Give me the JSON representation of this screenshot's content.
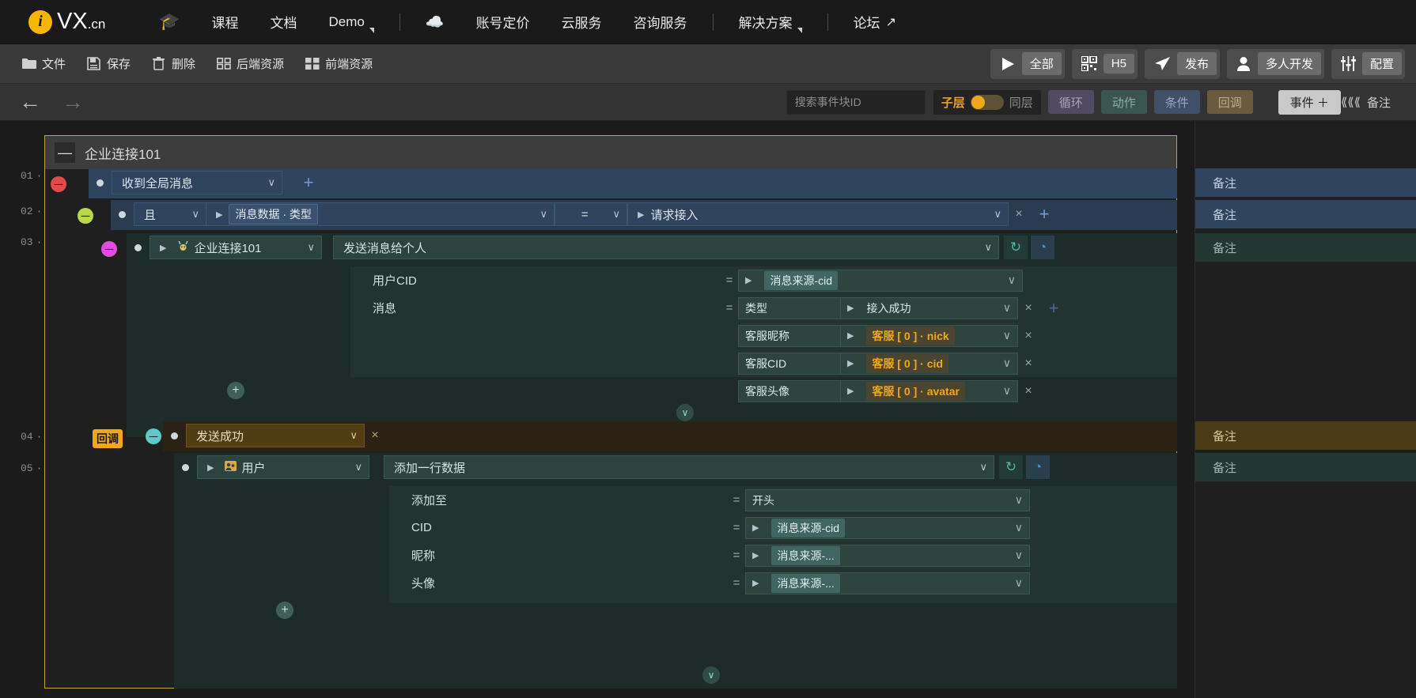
{
  "topnav": {
    "brand": {
      "logo_letter": "i",
      "name": "VX",
      "tld": ".cn"
    },
    "items": [
      {
        "name": "graduation-cap-icon",
        "label": "",
        "icon": "🎓",
        "type": "icon"
      },
      {
        "name": "courses",
        "label": "课程",
        "type": "link"
      },
      {
        "name": "docs",
        "label": "文档",
        "type": "link"
      },
      {
        "name": "demo",
        "label": "Demo",
        "type": "dropdown"
      },
      {
        "name": "separator",
        "label": "",
        "type": "sep"
      },
      {
        "name": "cloud-money-icon",
        "label": "",
        "icon": "💰",
        "type": "icon"
      },
      {
        "name": "pricing",
        "label": "账号定价",
        "type": "link"
      },
      {
        "name": "cloud-service",
        "label": "云服务",
        "type": "link"
      },
      {
        "name": "consulting",
        "label": "咨询服务",
        "type": "link"
      },
      {
        "name": "separator",
        "label": "",
        "type": "sep"
      },
      {
        "name": "solutions",
        "label": "解决方案",
        "type": "dropdown"
      },
      {
        "name": "separator",
        "label": "",
        "type": "sep"
      },
      {
        "name": "forum",
        "label": "论坛",
        "type": "external"
      }
    ]
  },
  "toolbar": {
    "left": [
      {
        "name": "file",
        "label": "文件",
        "icon": "folder"
      },
      {
        "name": "save",
        "label": "保存",
        "icon": "save"
      },
      {
        "name": "delete",
        "label": "删除",
        "icon": "trash"
      },
      {
        "name": "backend-resource",
        "label": "后端资源",
        "icon": "grid-outline"
      },
      {
        "name": "frontend-resource",
        "label": "前端资源",
        "icon": "grid-filled"
      }
    ],
    "right": [
      {
        "name": "run-all",
        "label": "全部",
        "icon": "play"
      },
      {
        "name": "h5-qr",
        "label": "H5",
        "icon": "qrcode"
      },
      {
        "name": "publish",
        "label": "发布",
        "icon": "send"
      },
      {
        "name": "multi-dev",
        "label": "多人开发",
        "icon": "user"
      },
      {
        "name": "settings",
        "label": "配置",
        "icon": "sliders"
      }
    ]
  },
  "subbar": {
    "back_icon": "←",
    "forward_icon": "→",
    "search_placeholder": "搜索事件块ID",
    "layer_toggle": {
      "on_label": "子层",
      "off_label": "同层",
      "state": "子层"
    },
    "chips": [
      {
        "name": "loop",
        "label": "循环",
        "color": "#514a63"
      },
      {
        "name": "action",
        "label": "动作",
        "color": "#3b5551"
      },
      {
        "name": "condition",
        "label": "条件",
        "color": "#3f5068"
      },
      {
        "name": "callback",
        "label": "回调",
        "color": "#6b5a3c"
      }
    ],
    "add_event": "事件 ＋",
    "notes_toggle": {
      "chevrons": "《〈",
      "label": "备注"
    }
  },
  "canvas": {
    "line_numbers": [
      "01",
      "02",
      "03",
      "04",
      "05"
    ],
    "event_block": {
      "title": "企业连接101",
      "collapse_icon": "—"
    },
    "row1": {
      "value": "收到全局消息",
      "caret": "∨",
      "plus": "+"
    },
    "row2": {
      "logic": "且",
      "caret": "∨",
      "triangle": "▶",
      "left_operand": "消息数据 · 类型",
      "operator": "=",
      "op_caret": "∨",
      "right_triangle": "▶",
      "right_operand": "请求接入",
      "close": "×",
      "plus": "+"
    },
    "row3": {
      "triangle": "▶",
      "resource_icon": "plug-icon",
      "resource": "企业连接101",
      "caret": "∨",
      "action_title": "发送消息给个人",
      "action_caret": "∨",
      "refresh_icon": "↻",
      "clock_icon": "◔",
      "plus_circle": "+",
      "params": [
        {
          "label": "用户CID",
          "eq": "=",
          "triangle": "▶",
          "value": "消息来源-cid",
          "value_style": "green-tag",
          "caret": "∨"
        },
        {
          "label": "消息",
          "eq": "=",
          "key": "类型",
          "triangle": "▶",
          "value": "接入成功",
          "value_style": "plain",
          "caret": "∨",
          "close": "×",
          "plus": "+"
        },
        {
          "label": "",
          "eq": "",
          "key": "客服昵称",
          "triangle": "▶",
          "value": "客服 [ 0 ] · nick",
          "value_style": "orange-tag",
          "caret": "∨",
          "close": "×"
        },
        {
          "label": "",
          "eq": "",
          "key": "客服CID",
          "triangle": "▶",
          "value": "客服 [ 0 ] · cid",
          "value_style": "orange-tag",
          "caret": "∨",
          "close": "×"
        },
        {
          "label": "",
          "eq": "",
          "key": "客服头像",
          "triangle": "▶",
          "value": "客服 [ 0 ] · avatar",
          "value_style": "orange-tag",
          "caret": "∨",
          "close": "×"
        }
      ],
      "collapse_chev": "∨"
    },
    "row4": {
      "badge": "回调",
      "value": "发送成功",
      "caret": "∨",
      "close": "×"
    },
    "row5": {
      "triangle": "▶",
      "resource_icon": "users-icon",
      "resource": "用户",
      "caret": "∨",
      "action_title": "添加一行数据",
      "action_caret": "∨",
      "refresh_icon": "↻",
      "clock_icon": "◔",
      "plus_circle": "+",
      "params": [
        {
          "label": "添加至",
          "eq": "=",
          "triangle": "",
          "value": "开头",
          "value_style": "plain",
          "caret": "∨"
        },
        {
          "label": "CID",
          "eq": "=",
          "triangle": "▶",
          "value": "消息来源-cid",
          "value_style": "green-tag",
          "caret": "∨"
        },
        {
          "label": "昵称",
          "eq": "=",
          "triangle": "▶",
          "value": "消息来源-...",
          "value_style": "green-tag",
          "caret": "∨"
        },
        {
          "label": "头像",
          "eq": "=",
          "triangle": "▶",
          "value": "消息来源-...",
          "value_style": "green-tag",
          "caret": "∨"
        }
      ],
      "collapse_chev": "∨"
    }
  },
  "notes_panel": {
    "rows": [
      {
        "label": "备注",
        "style": "blue"
      },
      {
        "label": "备注",
        "style": "blue"
      },
      {
        "label": "备注",
        "style": "green"
      },
      {
        "label": "备注",
        "style": "brown"
      },
      {
        "label": "备注",
        "style": "green"
      }
    ]
  },
  "colors": {
    "accent_orange": "#f0a81a",
    "event_border": "#caa02e",
    "blue_block": "#2f445e",
    "green_block": "#2b4440",
    "brown_block": "#503d14"
  }
}
